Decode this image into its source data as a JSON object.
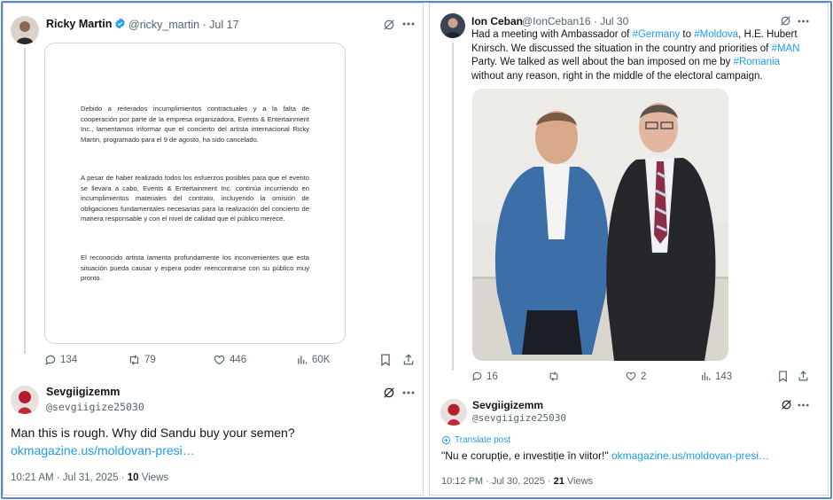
{
  "left_tweet": {
    "author_name": "Ricky Martin",
    "author_handle": "@ricky_martin",
    "date": "Jul 17",
    "statement": {
      "p1": "Debido a reiterados incumplimientos contractuales y a la falta de cooperación por parte de la empresa organizadora, Events & Entertainment Inc., lamentamos informar que el concierto del artista internacional Ricky Martin, programado para el 9 de agosto, ha sido cancelado.",
      "p2": "A pesar de haber realizado todos los esfuerzos posibles para que el evento se llevara a cabo, Events & Entertainment Inc. continúa incurriendo en incumplimientos materiales del contrato, incluyendo la omisión de obligaciones fundamentales necesarias para la realización del concierto de manera responsable y con el nivel de calidad que el público merece.",
      "p3": "El reconocido artista lamenta profundamente los inconvenientes que esta situación pueda causar y espera poder reencontrarse con su público muy pronto."
    },
    "replies": "134",
    "reposts": "79",
    "likes": "446",
    "views": "60K"
  },
  "left_reply": {
    "author_name": "Sevgiigizemm",
    "author_handle": "@sevgiigize25030",
    "text": "Man this is rough. Why did Sandu buy your semen?",
    "link": "okmagazine.us/moldovan-presi…",
    "time": "10:21 AM · Jul 31, 2025 · ",
    "views_count": "10",
    "views_label": " Views"
  },
  "right_tweet": {
    "author_name": "Ion Ceban",
    "author_handle": "@IonCeban16",
    "date": "Jul 30",
    "text_parts": {
      "a": "Had a meeting with Ambassador of ",
      "germany": "#Germany",
      "b": " to ",
      "moldova": "#Moldova",
      "c": ", H.E. Hubert Knirsch. We discussed the situation in the country and priorities of ",
      "man": "#MAN",
      "d": " Party. We talked as well about the ban imposed on me by ",
      "romania": "#Romania",
      "e": " without any reason, right in the middle of the electoral campaign."
    },
    "replies": "16",
    "reposts": "",
    "likes": "2",
    "views": "143"
  },
  "right_reply": {
    "author_name": "Sevgiigizemm",
    "author_handle": "@sevgiigize25030",
    "translate": "Translate post",
    "quote": "\"Nu e corupție, e investiție în viitor!\" ",
    "link": "okmagazine.us/moldovan-presi…",
    "time": "10:12 PM · Jul 30, 2025 · ",
    "views_count": "21",
    "views_label": " Views"
  },
  "colors": {
    "link": "#1d9bf0",
    "muted": "#536471",
    "border": "#cfd9de",
    "frame": "#5b87c9"
  }
}
